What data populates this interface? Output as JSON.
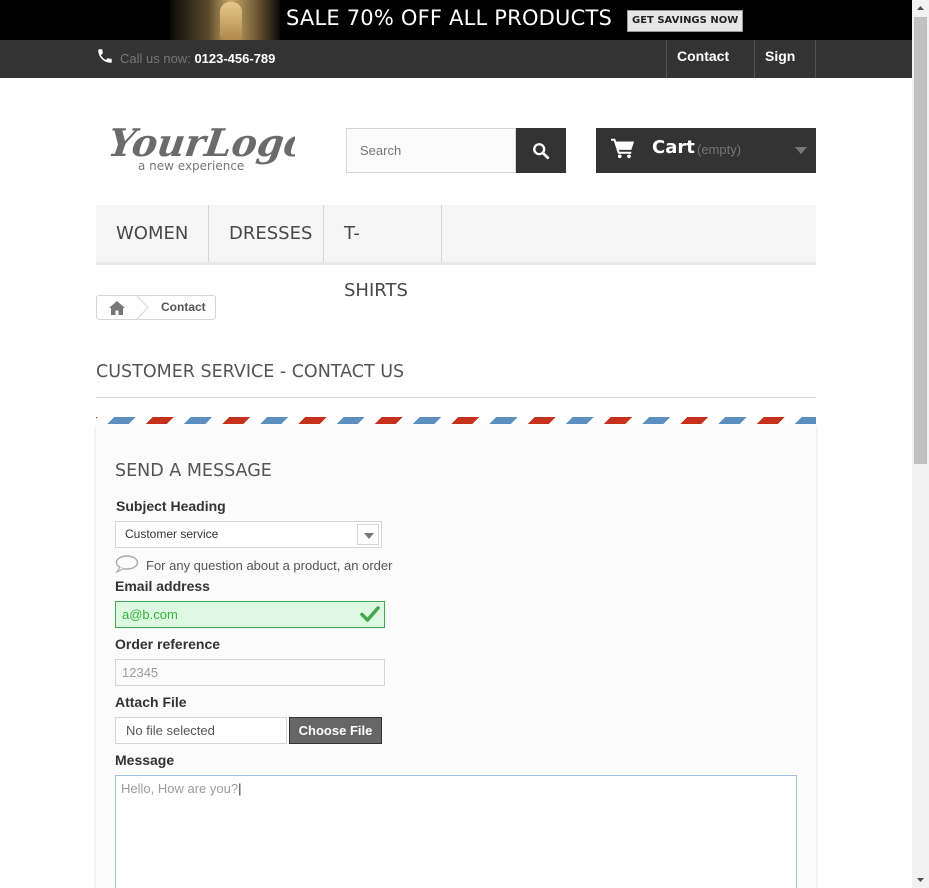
{
  "banner": {
    "sale_text": "SALE 70% OFF ALL PRODUCTS",
    "button_label": "GET SAVINGS NOW"
  },
  "topnav": {
    "call_label": "Call us now:",
    "phone": "0123-456-789",
    "contact_label": "Contact us",
    "signin_label": "Sign in"
  },
  "logo": {
    "text": "YourLogo",
    "tagline": "a new experience"
  },
  "search": {
    "placeholder": "Search"
  },
  "cart": {
    "label": "Cart",
    "status": "(empty)"
  },
  "menu": {
    "items": [
      "WOMEN",
      "DRESSES",
      "T-SHIRTS"
    ]
  },
  "breadcrumb": {
    "current": "Contact"
  },
  "page_heading": "CUSTOMER SERVICE - CONTACT US",
  "form": {
    "title": "SEND A MESSAGE",
    "subject_label": "Subject Heading",
    "subject_value": "Customer service",
    "subject_hint": "For any question about a product, an order",
    "email_label": "Email address",
    "email_value": "a@b.com",
    "order_label": "Order reference",
    "order_placeholder": "12345",
    "attach_label": "Attach File",
    "file_status": "No file selected",
    "choose_file_label": "Choose File",
    "message_label": "Message",
    "message_value": "Hello, How are you?"
  },
  "colors": {
    "dark_bar": "#333333",
    "valid_green": "#35b33f",
    "stripe_blue": "#5a8fbf",
    "stripe_red": "#c5311a"
  },
  "icons": [
    "phone-icon",
    "search-icon",
    "cart-icon",
    "chevron-down-icon",
    "home-icon",
    "speech-bubble-icon",
    "checkmark-icon"
  ]
}
